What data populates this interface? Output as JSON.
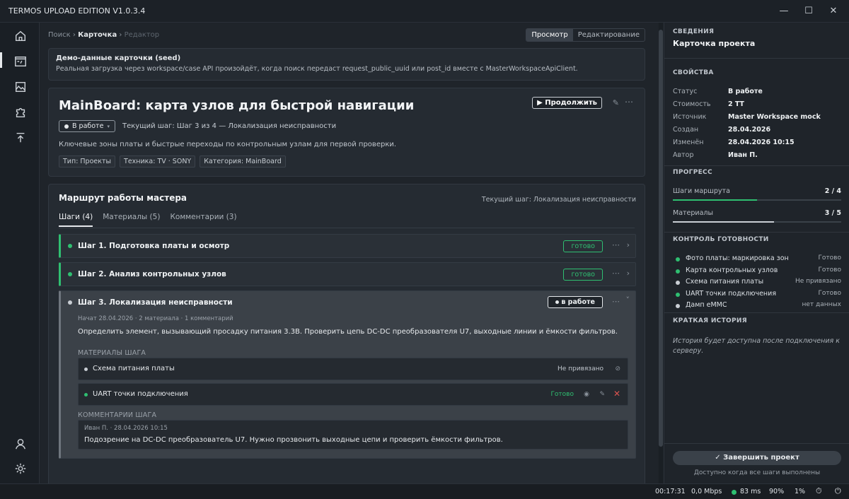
{
  "window": {
    "title": "TERMOS UPLOAD EDITION V1.0.3.4",
    "minimize": "—",
    "maximize": "☐",
    "close": "✕"
  },
  "breadcrumbs": {
    "search": "Поиск",
    "card": "Карточка",
    "editor": "Редактор",
    "sep": "›"
  },
  "mode": {
    "view": "Просмотр",
    "edit": "Редактирование"
  },
  "seed": {
    "title": "Демо-данные карточки (seed)",
    "description": "Реальная загрузка через workspace/case API произойдёт, когда поиск передаст request_public_uuid или post_id вместе с MasterWorkspaceApiClient."
  },
  "hero": {
    "title": "MainBoard: карта узлов для быстрой навигации",
    "status": "В работе",
    "current_step": "Текущий шаг: Шаг 3 из 4 — Локализация неисправности",
    "description": "Ключевые зоны платы и быстрые переходы по контрольным узлам для первой проверки.",
    "continue": "▶ Продолжить",
    "tags": [
      "Тип: Проекты",
      "Техника: TV · SONY",
      "Категория: MainBoard"
    ]
  },
  "route": {
    "title": "Маршрут работы мастера",
    "current": "Текущий шаг: Локализация неисправности",
    "tabs": [
      "Шаги (4)",
      "Материалы (5)",
      "Комментарии (3)"
    ],
    "steps": [
      {
        "name": "Шаг 1. Подготовка платы и осмотр",
        "badge": "готово"
      },
      {
        "name": "Шаг 2. Анализ контрольных узлов",
        "badge": "готово"
      },
      {
        "name": "Шаг 3. Локализация неисправности",
        "badge": "в работе",
        "meta": "Начат 28.04.2026 · 2 материала · 1 комментарий",
        "body": "Определить элемент, вызывающий просадку питания 3.3В. Проверить цепь DC-DC преобразователя U7, выходные линии и ёмкости фильтров.",
        "materials_label": "МАТЕРИАЛЫ ШАГА",
        "materials": [
          {
            "name": "Схема питания платы",
            "state": "Не привязано"
          },
          {
            "name": "UART точки подключения",
            "state": "Готово"
          }
        ],
        "comments_label": "КОММЕНТАРИИ ШАГА",
        "comment": {
          "author": "Иван П. · 28.04.2026 10:15",
          "text": "Подозрение на DC-DC преобразователь U7. Нужно прозвонить выходные цепи и проверить ёмкости фильтров."
        }
      }
    ]
  },
  "right": {
    "section": "СВЕДЕНИЯ",
    "card_title": "Карточка проекта",
    "props_label": "СВОЙСТВА",
    "props": [
      {
        "k": "Статус",
        "v": "В работе"
      },
      {
        "k": "Стоимость",
        "v": "2 ТТ"
      },
      {
        "k": "Источник",
        "v": "Master Workspace mock"
      },
      {
        "k": "Создан",
        "v": "28.04.2026"
      },
      {
        "k": "Изменён",
        "v": "28.04.2026 10:15"
      },
      {
        "k": "Автор",
        "v": "Иван П."
      }
    ],
    "progress_label": "ПРОГРЕСС",
    "progress": [
      {
        "k": "Шаги маршрута",
        "v": "2 / 4",
        "fraction": 0.5,
        "color": "#2fbf71"
      },
      {
        "k": "Материалы",
        "v": "3 / 5",
        "fraction": 0.6,
        "color": "#c9ced4"
      }
    ],
    "checks_label": "КОНТРОЛЬ ГОТОВНОСТИ",
    "checks": [
      {
        "l": "Фото платы: маркировка зон",
        "s": "Готово",
        "color": "#2fbf71"
      },
      {
        "l": "Карта контрольных узлов",
        "s": "Готово",
        "color": "#2fbf71"
      },
      {
        "l": "Схема питания платы",
        "s": "Не привязано",
        "color": "#c9ced4"
      },
      {
        "l": "UART точки подключения",
        "s": "Готово",
        "color": "#2fbf71"
      },
      {
        "l": "Дамп eMMC",
        "s": "нет данных",
        "color": "#c9ced4"
      }
    ],
    "history_label": "КРАТКАЯ ИСТОРИЯ",
    "history": "История будет доступна после подключения к серверу.",
    "finish": "✓ Завершить проект",
    "finish_note": "Доступно когда все шаги выполнены"
  },
  "statusbar": {
    "time": "00:17:31",
    "speed": "0,0 Mbps",
    "ping": "83 ms",
    "cpu": "90%",
    "mem": "1%"
  },
  "colors": {
    "green": "#2fbf71",
    "accent": "#e6e9ec"
  }
}
